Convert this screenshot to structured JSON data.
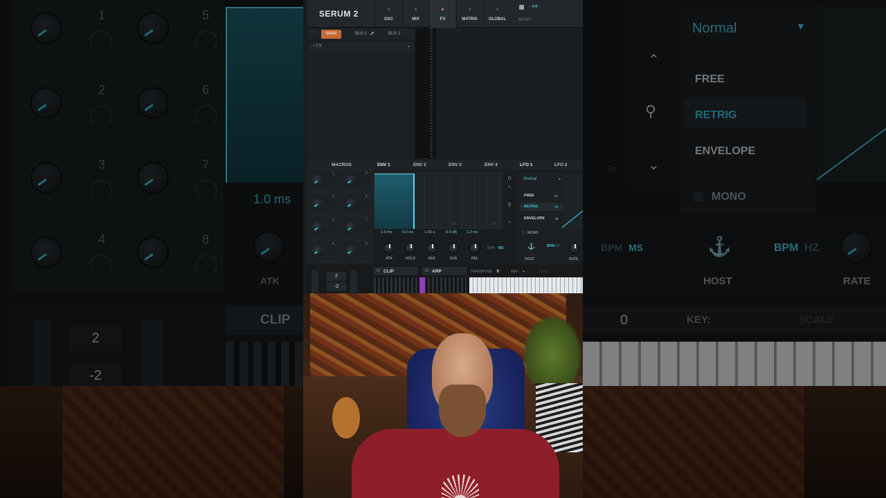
{
  "app": {
    "name": "SERUM 2"
  },
  "nav_tabs": [
    {
      "label": "OSC"
    },
    {
      "label": "MIX"
    },
    {
      "label": "FX",
      "active": true
    },
    {
      "label": "MATRIX"
    },
    {
      "label": "GLOBAL"
    }
  ],
  "preset": {
    "name": "- Init -",
    "artist_label": "ARTIST:"
  },
  "fx": {
    "buses": [
      {
        "label": "MAIN",
        "active": true
      },
      {
        "label": "BUS 1"
      },
      {
        "label": "BUS 2"
      }
    ],
    "add_label": "+ FX"
  },
  "mod": {
    "macros_label": "MACROS",
    "tabs": [
      {
        "label": "ENV 1",
        "active": true
      },
      {
        "label": "ENV 2"
      },
      {
        "label": "ENV 3"
      },
      {
        "label": "ENV 4"
      },
      {
        "label": "LFO 1",
        "active": true
      },
      {
        "label": "LFO 2"
      }
    ],
    "macro_numbers": [
      "1",
      "5",
      "2",
      "6",
      "3",
      "7",
      "4",
      "8"
    ],
    "env_values": [
      "1.0 ms",
      "0.0 ms",
      "1.00 s",
      "0.0 dB",
      "1.2 ms"
    ],
    "env_axis": [
      "2s",
      "3s"
    ],
    "env_knobs": [
      "ATK",
      "HOLD",
      "DEC",
      "SUS",
      "REL"
    ],
    "env_bpm": {
      "on": "BPM",
      "off": "MS"
    },
    "lfo": {
      "shape_select": "Normal",
      "modes": [
        {
          "label": "FREE"
        },
        {
          "label": "RETRIG",
          "active": true
        },
        {
          "label": "ENVELOPE"
        }
      ],
      "mono_label": "MONO",
      "host_label": "HOST",
      "rate_label": "RATE",
      "bpm": {
        "on": "BPM",
        "off": "HZ"
      }
    }
  },
  "bottom": {
    "clip_label": "CLIP",
    "arp_label": "ARP",
    "transpose_label": "TRANSPOSE:",
    "transpose_value": "0",
    "key_label": "KEY:",
    "key_value": "–",
    "scale_label": "SCALE",
    "octave_up": "2",
    "octave_down": "-2"
  },
  "background_zoom": {
    "numbers": [
      "1",
      "5",
      "2",
      "6",
      "3",
      "7",
      "4",
      "8"
    ],
    "atk_value": "1.0 ms",
    "atk_label": "ATK",
    "clip_label": "CLIP",
    "octave_up": "2",
    "octave_down": "-2",
    "lfo_select": "Normal",
    "modes": [
      "FREE",
      "RETRIG",
      "ENVELOPE"
    ],
    "mono_label": "MONO",
    "host_label": "HOST",
    "rate_label": "RATE",
    "bpm_on": "BPM",
    "ms_off": "MS",
    "hz_off": "HZ",
    "transpose_value": "0",
    "key_label": "KEY:",
    "scale_label": "SCALE",
    "axis_label": "3s"
  },
  "colors": {
    "accent": "#39c0d6",
    "fx_active": "#c56a35",
    "arp_step": "#8d3fb3"
  }
}
